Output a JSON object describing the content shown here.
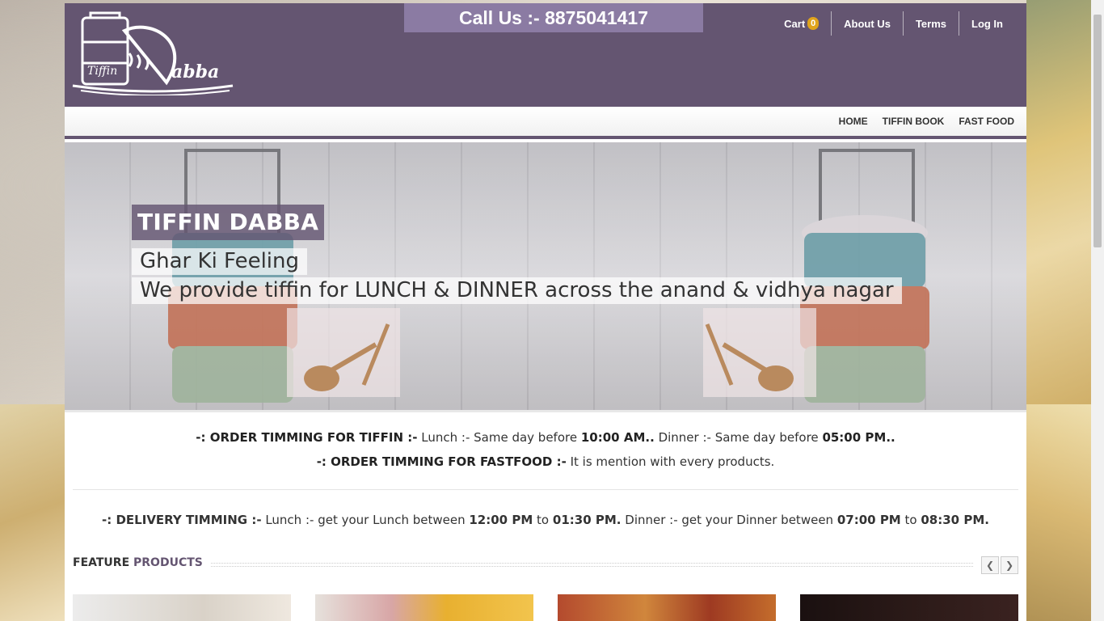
{
  "header": {
    "logo_alt": "Tiffin Dabba",
    "logo_small": "Tiffin",
    "logo_script": "abba",
    "call_us": "Call Us :- 8875041417",
    "cart_label": "Cart",
    "cart_count": "0",
    "about_label": "About Us",
    "terms_label": "Terms",
    "login_label": "Log In"
  },
  "nav": {
    "home": "HOME",
    "tiffin_book": "TIFFIN BOOK",
    "fast_food": "FAST FOOD"
  },
  "hero": {
    "title": "TIFFIN DABBA",
    "subtitle1": "Ghar Ki Feeling",
    "subtitle2": "We provide tiffin for LUNCH & DINNER across the anand & vidhya nagar"
  },
  "order_timing": {
    "tiffin_label": "-: ORDER TIMMING FOR TIFFIN :-",
    "lunch_text": "Lunch :- Same day before",
    "lunch_time": "10:00 AM..",
    "dinner_text": "Dinner :- Same day before",
    "dinner_time": "05:00 PM..",
    "fastfood_label": "-: ORDER TIMMING FOR FASTFOOD :-",
    "fastfood_text": "It is mention with every products."
  },
  "delivery": {
    "label": "-: DELIVERY TIMMING :-",
    "lunch_text": "Lunch :- get your Lunch between",
    "lunch_from": "12:00 PM",
    "to1": "to",
    "lunch_to": "01:30 PM.",
    "dinner_text": "Dinner :- get your Dinner between",
    "dinner_from": "07:00 PM",
    "to2": "to",
    "dinner_to": "08:30 PM."
  },
  "featured": {
    "word1": "FEATURE",
    "word2": "PRODUCTS",
    "prev_icon": "chevron-left-icon",
    "next_icon": "chevron-right-icon"
  },
  "colors": {
    "brand": "#645571",
    "call_bg": "#8b7ba3",
    "badge": "#e0a41c"
  }
}
